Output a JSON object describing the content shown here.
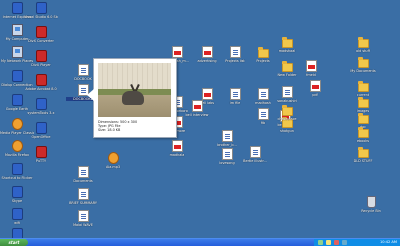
{
  "desktop": {
    "icons": [
      {
        "name": "internet-explorer",
        "label": "Internet Explorer",
        "glyph": "app"
      },
      {
        "name": "my-computer",
        "label": "My Computer",
        "glyph": "pc"
      },
      {
        "name": "my-network-places",
        "label": "My Network Places",
        "glyph": "pc"
      },
      {
        "name": "dialup-connection",
        "label": "Dialup Connection",
        "glyph": "app"
      },
      {
        "name": "google-earth",
        "label": "Google Earth",
        "glyph": "app"
      },
      {
        "name": "media-player-classic",
        "label": "Media Player Classic",
        "glyph": "media"
      },
      {
        "name": "mozilla-firefox",
        "label": "Mozilla Firefox",
        "glyph": "media"
      },
      {
        "name": "shortcut-to-flicker",
        "label": "Shortcut to Flicker",
        "glyph": "app"
      },
      {
        "name": "skype",
        "label": "Skype",
        "glyph": "app"
      },
      {
        "name": "wifi",
        "label": "wifi",
        "glyph": "app"
      },
      {
        "name": "worldwide-telescope",
        "label": "WorldWide Telescope",
        "glyph": "app"
      },
      {
        "name": "visual-studio",
        "label": "Visual Studio 6.0 Studio 6.0",
        "glyph": "app"
      },
      {
        "name": "dc-converter",
        "label": "DivX Converter",
        "glyph": "red"
      },
      {
        "name": "divx-player",
        "label": "DivX Player",
        "glyph": "red"
      },
      {
        "name": "acrobat-reader",
        "label": "Adobe Acrobat 8.0",
        "glyph": "red"
      },
      {
        "name": "systemtools",
        "label": "systemTools 3.x",
        "glyph": "app"
      },
      {
        "name": "openoffice",
        "label": "OpenOffice",
        "glyph": "app"
      },
      {
        "name": "putty",
        "label": "PuTTY",
        "glyph": "red"
      },
      {
        "name": "doc-docbook1",
        "label": "DOCBOOK",
        "glyph": "doc"
      },
      {
        "name": "doc-docbook2",
        "label": "DOCBOOK2",
        "glyph": "doc",
        "selected": true
      },
      {
        "name": "documents",
        "label": "Documents",
        "glyph": "doc"
      },
      {
        "name": "brief-summary",
        "label": "BRIEF SUMMARY",
        "glyph": "doc"
      },
      {
        "name": "malai-wave",
        "label": "Malai WAVE",
        "glyph": "doc"
      },
      {
        "name": "aia-mp3",
        "label": "Aia.mp3",
        "glyph": "media"
      },
      {
        "name": "madhosh",
        "label": "madhosh_m...",
        "glyph": "pdf"
      },
      {
        "name": "advertising",
        "label": "advertising",
        "glyph": "pdf"
      },
      {
        "name": "projects-list",
        "label": "Projects list",
        "glyph": "doc"
      },
      {
        "name": "projects",
        "label": "Projects",
        "glyph": "folder"
      },
      {
        "name": "madmore",
        "label": "madmore",
        "glyph": "pdf"
      },
      {
        "name": "bell-labs",
        "label": "bell labs",
        "glyph": "pdf"
      },
      {
        "name": "im-file",
        "label": "im file",
        "glyph": "doc"
      },
      {
        "name": "madhosh2",
        "label": "madhosh",
        "glyph": "doc"
      },
      {
        "name": "blog-borboro",
        "label": "blog borboro",
        "glyph": "doc"
      },
      {
        "name": "bengali-brother",
        "label": "brother_b...",
        "glyph": "doc"
      },
      {
        "name": "bertie",
        "label": "Bertie illustr...",
        "glyph": "doc"
      },
      {
        "name": "lovesong",
        "label": "lovesong",
        "glyph": "doc"
      },
      {
        "name": "sonabushiri",
        "label": "sonabushiri",
        "glyph": "doc"
      },
      {
        "name": "madshaal",
        "label": "madshaal",
        "glyph": "folder"
      },
      {
        "name": "bell-from",
        "label": "bell from",
        "glyph": "pdf"
      },
      {
        "name": "new-folder",
        "label": "New Folder",
        "glyph": "folder"
      },
      {
        "name": "fmeld",
        "label": "fmeld",
        "glyph": "pdf"
      },
      {
        "name": "fib",
        "label": "fib",
        "glyph": "doc"
      },
      {
        "name": "madhala",
        "label": "madhala",
        "glyph": "pdf"
      },
      {
        "name": "bell-interview",
        "label": "bell interview",
        "glyph": "pdf"
      },
      {
        "name": "shotgun",
        "label": "shotgun",
        "glyph": "folder"
      },
      {
        "name": "chaseplace",
        "label": "chaseplace",
        "glyph": "folder"
      },
      {
        "name": "old-stuff",
        "label": "old stuff",
        "glyph": "folder"
      },
      {
        "name": "my-documents",
        "label": "My Documents",
        "glyph": "folder"
      },
      {
        "name": "current",
        "label": "current",
        "glyph": "folder"
      },
      {
        "name": "images",
        "label": "images",
        "glyph": "folder"
      },
      {
        "name": "doc",
        "label": "doc",
        "glyph": "folder"
      },
      {
        "name": "ebooks",
        "label": "ebooks",
        "glyph": "folder"
      },
      {
        "name": "dld-stuff",
        "label": "DLD STUFF",
        "glyph": "folder"
      },
      {
        "name": "pdf-1",
        "label": "pdf",
        "glyph": "pdf"
      },
      {
        "name": "recycle-bin",
        "label": "Recycle Bin",
        "glyph": "bin"
      }
    ]
  },
  "tooltip": {
    "dimensions": "Dimensions: 500 x 300",
    "type": "Type: JPG File",
    "size": "Size: 18.0 KB"
  },
  "taskbar": {
    "start_label": "start",
    "clock": "10:42 AM"
  }
}
